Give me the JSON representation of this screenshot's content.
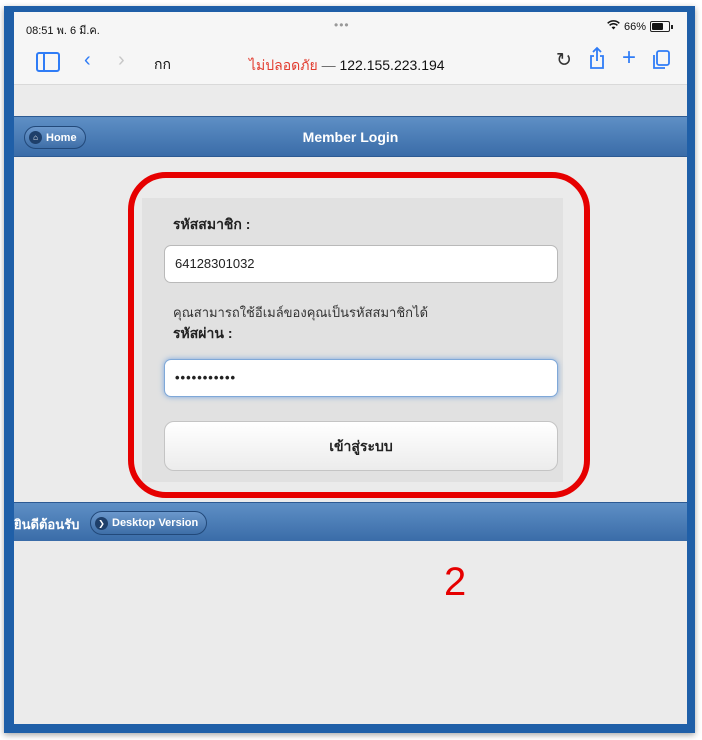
{
  "status": {
    "time_date": "08:51  พ. 6 มี.ค.",
    "dots": "•••",
    "battery": "66%"
  },
  "browser": {
    "text_size_label": "กก",
    "insecure_label": "ไม่ปลอดภัย",
    "separator": "—",
    "address": "122.155.223.194"
  },
  "header": {
    "home_label": "Home",
    "title": "Member Login"
  },
  "form": {
    "member_id_label": "รหัสสมาชิก :",
    "member_id_value": "64128301032",
    "hint": "คุณสามารถใช้อีเมล์ของคุณเป็นรหัสสมาชิกได้",
    "password_label": "รหัสผ่าน :",
    "password_value": "•••••••••••",
    "login_label": "เข้าสู่ระบบ"
  },
  "footer": {
    "welcome": "ยินดีต้อนรับ",
    "desktop_label": "Desktop Version"
  },
  "annotation": {
    "step": "2",
    "color": "#e60000"
  }
}
